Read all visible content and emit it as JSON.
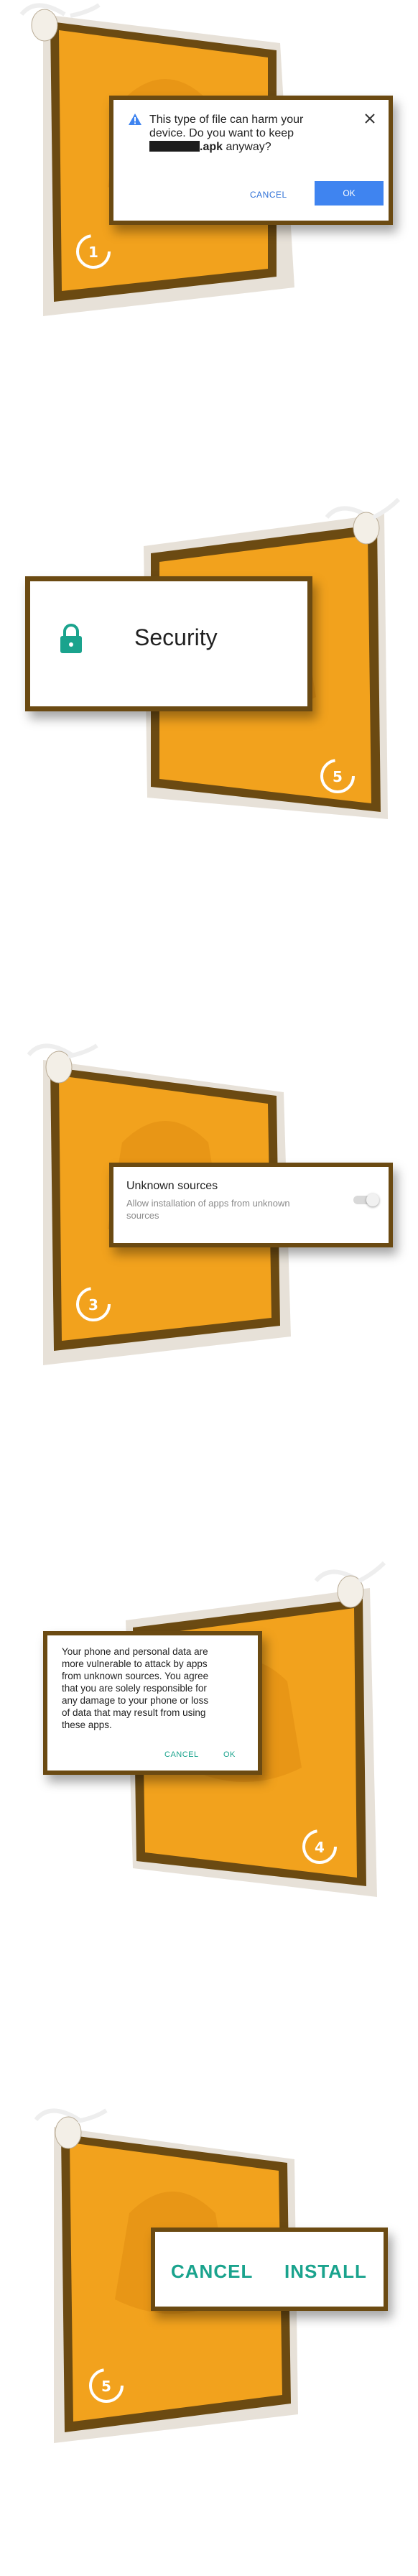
{
  "step1": {
    "badge_number": "1",
    "warning_line1": "This type of file can harm your",
    "warning_line2": "device. Do you want to keep",
    "file_ext": ".apk",
    "warning_tail": " anyway?",
    "cancel_label": "CANCEL",
    "ok_label": "OK",
    "icons": [
      "warning-icon",
      "close-icon"
    ]
  },
  "step2": {
    "badge_number": "5",
    "title": "Security",
    "icons": [
      "lock-icon"
    ]
  },
  "step3": {
    "badge_number": "3",
    "title": "Unknown sources",
    "subtitle_line1": "Allow installation of apps from unknown",
    "subtitle_line2": "sources",
    "toggle_on": false
  },
  "step4": {
    "badge_number": "4",
    "lines": [
      "Your phone and personal data are",
      "more vulnerable to attack by apps",
      "from unknown sources. You agree",
      "that you are solely responsible for",
      "any damage to your phone or loss",
      "of data that may result from using",
      "these apps."
    ],
    "cancel_label": "CANCEL",
    "ok_label": "OK"
  },
  "step5": {
    "badge_number": "5",
    "cancel_label": "CANCEL",
    "install_label": "INSTALL"
  },
  "colors": {
    "poster_orange": "#f2a21d",
    "frame_brown": "#6b4a12",
    "accent_blue": "#3f84f0",
    "accent_teal": "#1aa38d"
  }
}
